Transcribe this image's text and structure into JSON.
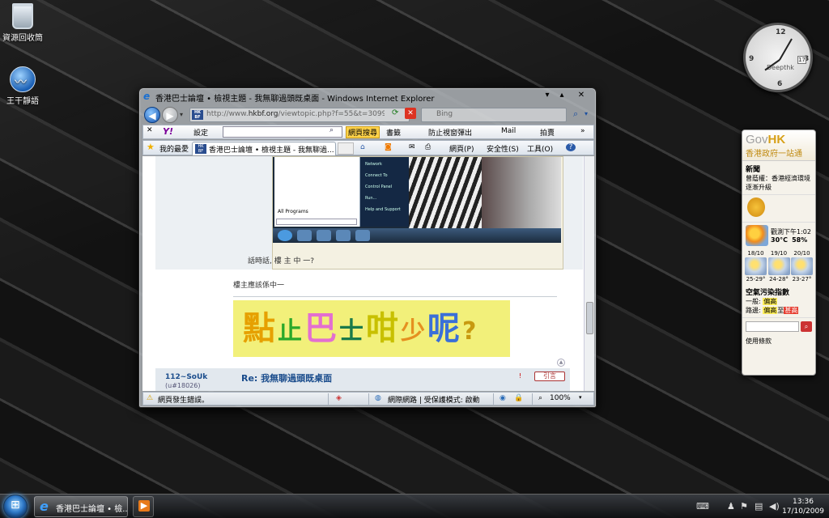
{
  "desktop": {
    "icons": [
      {
        "label": "資源回收筒"
      },
      {
        "label": "王干靜語"
      }
    ]
  },
  "clock_gadget": {
    "brand": "Deepthk",
    "date": "17",
    "numerals": [
      "12",
      "3",
      "6",
      "9"
    ]
  },
  "govhk": {
    "logo_gov": "Gov",
    "logo_hk": "HK",
    "logo_sub": "香港政府一站通",
    "news_title": "新聞",
    "news_item": "曾蔭權：香港經濟環境逐漸升級",
    "weather_now_label": "觀測下午1:02",
    "temperature": "30°C",
    "humidity": "58%",
    "forecast": [
      {
        "date": "18/10",
        "range": "25-29°"
      },
      {
        "date": "19/10",
        "range": "24-28°"
      },
      {
        "date": "20/10",
        "range": "23-27°"
      }
    ],
    "aqi_title": "空氣污染指數",
    "aqi_general_label": "一般:",
    "aqi_general_value": "偏高",
    "aqi_road_label": "路邊:",
    "aqi_road_value_a": "偏高",
    "aqi_road_to": "至",
    "aqi_road_value_b": "甚高",
    "footer": "使用條款"
  },
  "ie_window": {
    "title": "香港巴士論壇 • 檢視主題 - 我無聊過頭既桌面 - Windows Internet Explorer",
    "address_url_prefix": "http://www.",
    "address_url_domain": "hkbf.org",
    "address_url_rest": "/viewtopic.php?f=55&t=30998&st...",
    "search_placeholder": "Bing",
    "yahoo_toolbar": {
      "logo": "Y!",
      "settings": "設定",
      "web_search": "網頁搜尋",
      "bookmarks": "書籤",
      "popup_block": "防止視窗彈出",
      "mail": "Mail",
      "auction": "拍賣"
    },
    "favorites_bar": {
      "favorites": "我的最愛",
      "tab_title": "香港巴士論壇 • 檢視主題 - 我無聊過...",
      "page_menu": "網頁(P)",
      "safety_menu": "安全性(S)",
      "tools_menu": "工具(O)",
      "help_menu": "?"
    },
    "content": {
      "startmenu_all_programs": "All Programs",
      "startmenu_right": [
        "Network",
        "Connect To",
        "Control Panel",
        "Run...",
        "Help and Support"
      ],
      "quote_text": "話時話, 樓 主 中 一?",
      "reply_text": "樓主應該係中一",
      "banner_chars": [
        {
          "ch": "點",
          "color": "#e6a000"
        },
        {
          "ch": "止",
          "color": "#2aa82a"
        },
        {
          "ch": "巴",
          "color": "#e36fd0"
        },
        {
          "ch": "士",
          "color": "#1a7a4a"
        },
        {
          "ch": "咁",
          "color": "#c8c000"
        },
        {
          "ch": "少",
          "color": "#e59020"
        },
        {
          "ch": "呢",
          "color": "#3a6fd8"
        },
        {
          "ch": "?",
          "color": "#c89a10"
        }
      ],
      "post_author": "112~SoUk",
      "post_uid": "(u#18026)",
      "post_title": "Re: 我無聊過頭既桌面",
      "quote_button": "引言"
    },
    "status_bar": {
      "message": "網頁發生錯誤。",
      "zone": "網際網路 | 受保護模式: 啟動",
      "zoom": "100%"
    }
  },
  "taskbar": {
    "task_button_label": "香港巴士論壇 • 檢...",
    "time": "13:36",
    "date": "17/10/2009"
  }
}
